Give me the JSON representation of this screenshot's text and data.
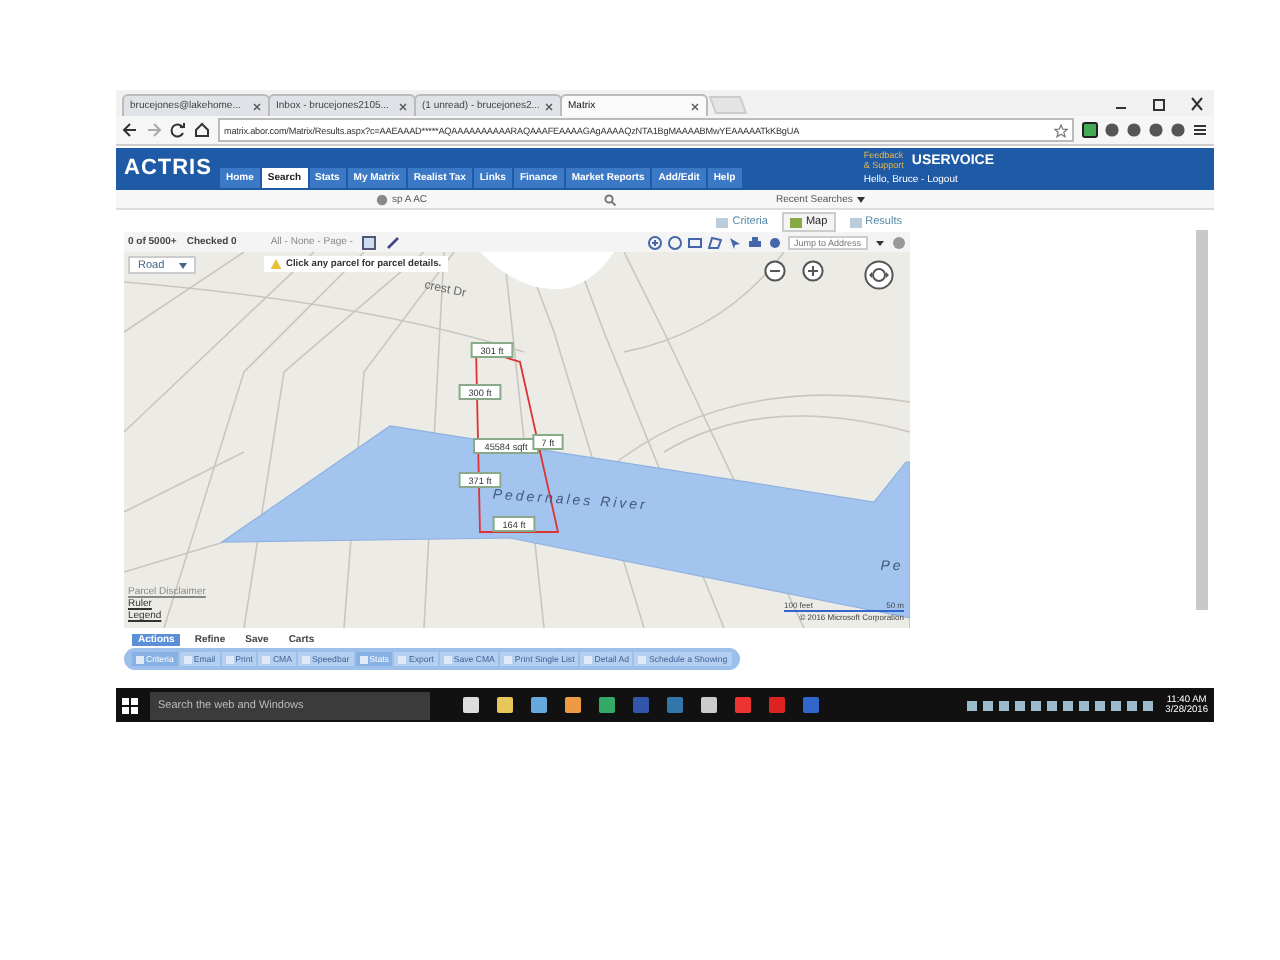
{
  "browser": {
    "tabs": [
      {
        "label": "brucejones@lakehome...",
        "selected": false
      },
      {
        "label": "Inbox - brucejones2105...",
        "selected": false
      },
      {
        "label": "(1 unread) - brucejones2...",
        "selected": false
      },
      {
        "label": "Matrix",
        "selected": true
      }
    ],
    "address": "matrix.abor.com/Matrix/Results.aspx?c=AAEAAAD*****AQAAAAAAAAAARAQAAAFEAAAAGAgAAAAQzNTA1BgMAAAABMwYEAAAAATkKBgUA"
  },
  "header": {
    "logo": "ACTRIS",
    "nav": [
      {
        "label": "Home",
        "selected": false
      },
      {
        "label": "Search",
        "selected": true
      },
      {
        "label": "Stats",
        "selected": false
      },
      {
        "label": "My Matrix",
        "selected": false
      },
      {
        "label": "Realist Tax",
        "selected": false
      },
      {
        "label": "Links",
        "selected": false
      },
      {
        "label": "Finance",
        "selected": false
      },
      {
        "label": "Market Reports",
        "selected": false
      },
      {
        "label": "Add/Edit",
        "selected": false
      },
      {
        "label": "Help",
        "selected": false
      }
    ],
    "feedback": "Feedback & Support",
    "uservoice": "USERVOICE",
    "greeting": "Hello, Bruce - Logout"
  },
  "search_bar": {
    "value": "sp A AC",
    "recent": "Recent Searches"
  },
  "view_tabs": [
    {
      "label": "Criteria",
      "selected": false
    },
    {
      "label": "Map",
      "selected": true
    },
    {
      "label": "Results",
      "selected": false
    }
  ],
  "results": {
    "count": "0 of 5000+",
    "checked": "Checked 0",
    "select": "All - None - Page -",
    "jump": {
      "placeholder": "Jump to Address"
    }
  },
  "map": {
    "layer": "Road",
    "notice": "Click any parcel for parcel details.",
    "street": "crest Dr",
    "measurements": [
      "301 ft",
      "300 ft",
      "45584 sqft",
      "7 ft",
      "371 ft",
      "164 ft"
    ],
    "river": "Pedernales River",
    "river_2": "Pe",
    "links": [
      "Parcel Disclaimer",
      "Ruler",
      "Legend"
    ],
    "scale": [
      "100 feet",
      "50 m"
    ],
    "copyright": "© 2016 Microsoft Corporation"
  },
  "action_tabs": [
    {
      "label": "Actions",
      "selected": true
    },
    {
      "label": "Refine",
      "selected": false
    },
    {
      "label": "Save",
      "selected": false
    },
    {
      "label": "Carts",
      "selected": false
    }
  ],
  "actions": [
    {
      "label": "Criteria",
      "disabled": false
    },
    {
      "label": "Email",
      "disabled": true
    },
    {
      "label": "Print",
      "disabled": true
    },
    {
      "label": "CMA",
      "disabled": true
    },
    {
      "label": "Speedbar",
      "disabled": true
    },
    {
      "label": "Stats",
      "disabled": false
    },
    {
      "label": "Export",
      "disabled": true
    },
    {
      "label": "Save CMA",
      "disabled": true
    },
    {
      "label": "Print Single List",
      "disabled": true
    },
    {
      "label": "Detail Ad",
      "disabled": true
    },
    {
      "label": "Schedule a Showing",
      "disabled": true
    }
  ],
  "taskbar": {
    "search": {
      "placeholder": "Search the web and Windows"
    },
    "time": "11:40 AM",
    "date": "3/28/2016"
  }
}
